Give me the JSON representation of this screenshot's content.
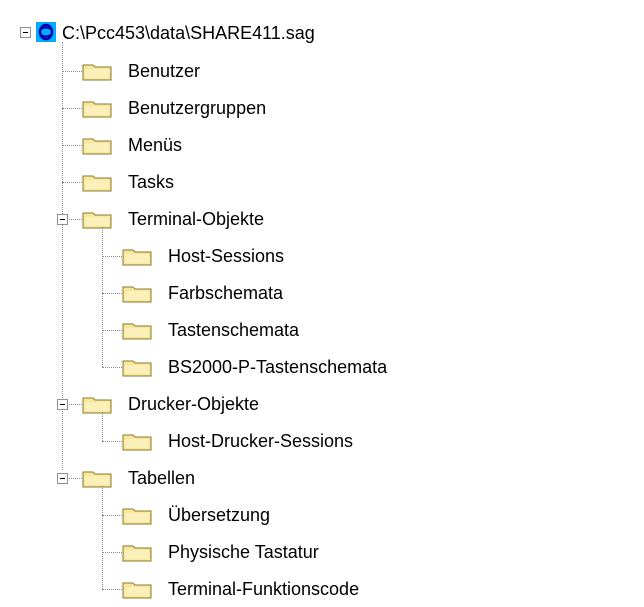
{
  "root": {
    "label": "C:\\Pcc453\\data\\SHARE411.sag",
    "icon": "database-icon",
    "expanded": true
  },
  "items": [
    {
      "label": "Benutzer",
      "icon": "folder-icon"
    },
    {
      "label": "Benutzergruppen",
      "icon": "folder-icon"
    },
    {
      "label": "Menüs",
      "icon": "folder-icon"
    },
    {
      "label": "Tasks",
      "icon": "folder-icon"
    },
    {
      "label": "Terminal-Objekte",
      "icon": "folder-icon",
      "expanded": true,
      "children": [
        {
          "label": "Host-Sessions",
          "icon": "folder-icon"
        },
        {
          "label": "Farbschemata",
          "icon": "folder-icon"
        },
        {
          "label": "Tastenschemata",
          "icon": "folder-icon"
        },
        {
          "label": "BS2000-P-Tastenschemata",
          "icon": "folder-icon"
        }
      ]
    },
    {
      "label": "Drucker-Objekte",
      "icon": "folder-icon",
      "expanded": true,
      "children": [
        {
          "label": "Host-Drucker-Sessions",
          "icon": "folder-icon"
        }
      ]
    },
    {
      "label": "Tabellen",
      "icon": "folder-icon",
      "expanded": true,
      "children": [
        {
          "label": "Übersetzung",
          "icon": "folder-icon"
        },
        {
          "label": "Physische Tastatur",
          "icon": "folder-icon"
        },
        {
          "label": "Terminal-Funktionscode",
          "icon": "folder-icon"
        }
      ]
    }
  ],
  "colors": {
    "folder_fill": "#f6e79a",
    "folder_edge": "#8a7a2c",
    "db_background": "#00aaff",
    "db_symbol": "#0000aa",
    "tree_line": "#8a8a8a"
  }
}
